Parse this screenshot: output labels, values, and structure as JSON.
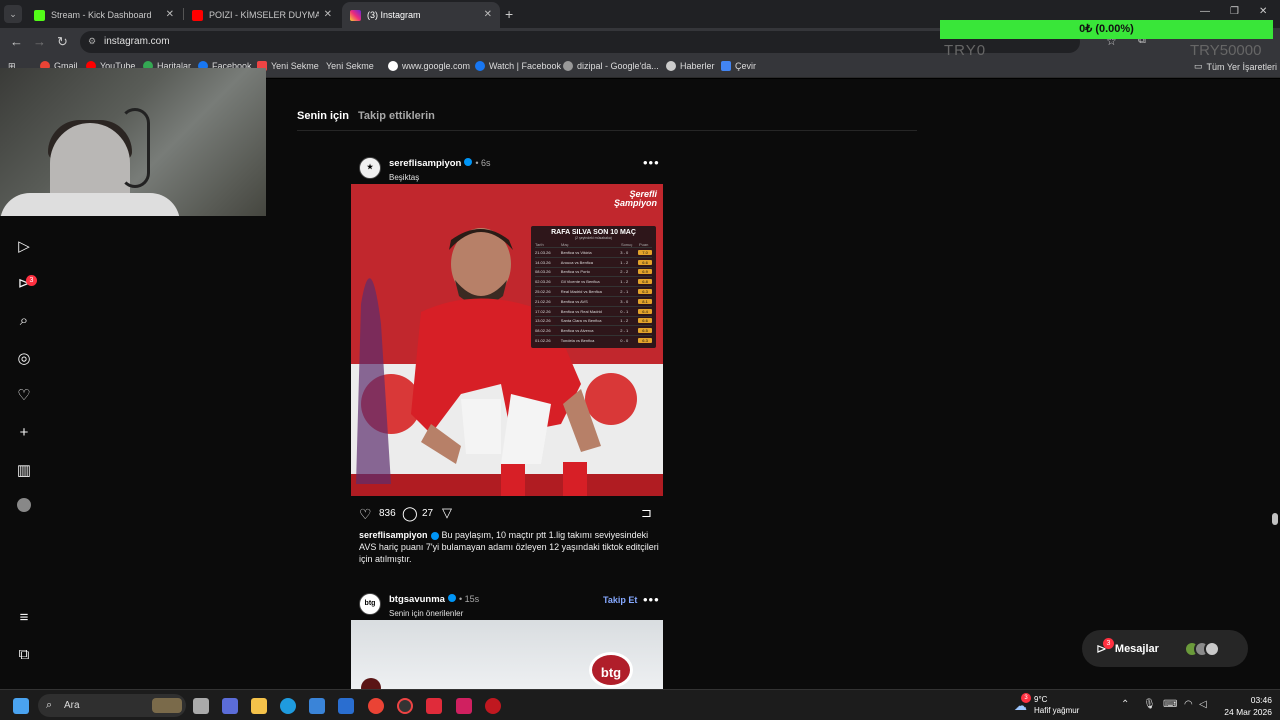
{
  "browser": {
    "tabs": [
      {
        "title": "Stream - Kick Dashboard",
        "active": false
      },
      {
        "title": "POIZI - KİMSELER DUYMASIN (",
        "active": false
      },
      {
        "title": "(3) Instagram",
        "active": true
      }
    ],
    "url": "instagram.com",
    "bookmarks": [
      "Gmail",
      "YouTube",
      "Haritalar",
      "Facebook",
      "Yeni Sekme",
      "Yeni Sekme",
      "www.google.com",
      "Watch | Facebook",
      "dizipal - Google'da...",
      "Haberler",
      "Çevir"
    ],
    "all_bookmarks": "Tüm Yer İşaretleri"
  },
  "overlay": {
    "bar_text": "0₺ (0.00%)",
    "try_left": "TRY0",
    "try_right": "TRY50000",
    "bar_color": "#39e639"
  },
  "sidebar": {
    "icons": [
      "reels-icon",
      "messages-icon",
      "search-icon",
      "explore-icon",
      "heart-icon",
      "create-icon",
      "dashboard-icon",
      "profile-avatar",
      "menu-icon",
      "more-icon"
    ],
    "messages_badge": "3"
  },
  "feed": {
    "tabs": [
      "Senin için",
      "Takip ettiklerin"
    ]
  },
  "post1": {
    "username": "sereflisampiyon",
    "time": "6s",
    "location": "Beşiktaş",
    "image_title": "RAFA SILVA SON 10 MAÇ",
    "image_subtitle": "(2 şeyindeki müsabaka)",
    "table_headers": [
      "Tarih",
      "Maç",
      "Sonuç",
      "Puan"
    ],
    "table_rows": [
      [
        "21.03.26",
        "Benfica vs Vitória",
        "3 - 0",
        "7.0"
      ],
      [
        "14.03.26",
        "Arouca vs Benfica",
        "1 - 2",
        "6.6"
      ],
      [
        "08.03.26",
        "Benfica vs Porto",
        "2 - 2",
        "6.9"
      ],
      [
        "02.03.26",
        "Gil Vicente vs Benfica",
        "1 - 2",
        "6.8"
      ],
      [
        "25.02.26",
        "Real Madrid vs Benfica",
        "2 - 1",
        "6.3"
      ],
      [
        "21.02.26",
        "Benfica vs AVS",
        "3 - 0",
        "8.1"
      ],
      [
        "17.02.26",
        "Benfica vs Real Madrid",
        "0 - 1",
        "6.4"
      ],
      [
        "13.02.26",
        "Santa Clara vs Benfica",
        "1 - 2",
        "6.6"
      ],
      [
        "08.02.26",
        "Benfica vs Alverca",
        "2 - 1",
        "6.5"
      ],
      [
        "01.02.26",
        "Tondela vs Benfica",
        "0 - 0",
        "6.3"
      ]
    ],
    "brand": "Şerefli Şampiyon",
    "likes": "836",
    "comments": "27",
    "caption_user": "sereflisampiyon",
    "caption_text": "Bu paylaşım, 10 maçtır ptt 1.lig takımı seviyesindeki AVS hariç puanı 7'yi bulamayan adamı özleyen 12 yaşındaki tiktok editçileri için atılmıştır."
  },
  "post2": {
    "username": "btgsavunma",
    "time": "15s",
    "subtitle": "Senin için önerilenler",
    "follow_label": "Takip Et",
    "logo_text": "btg"
  },
  "messages": {
    "label": "Mesajlar",
    "badge": "3"
  },
  "taskbar": {
    "search_placeholder": "Ara",
    "weather_temp": "9°C",
    "weather_desc": "Hafif yağmur",
    "time": "03:46",
    "date": "24 Mar 2026",
    "weather_badge": "3"
  }
}
